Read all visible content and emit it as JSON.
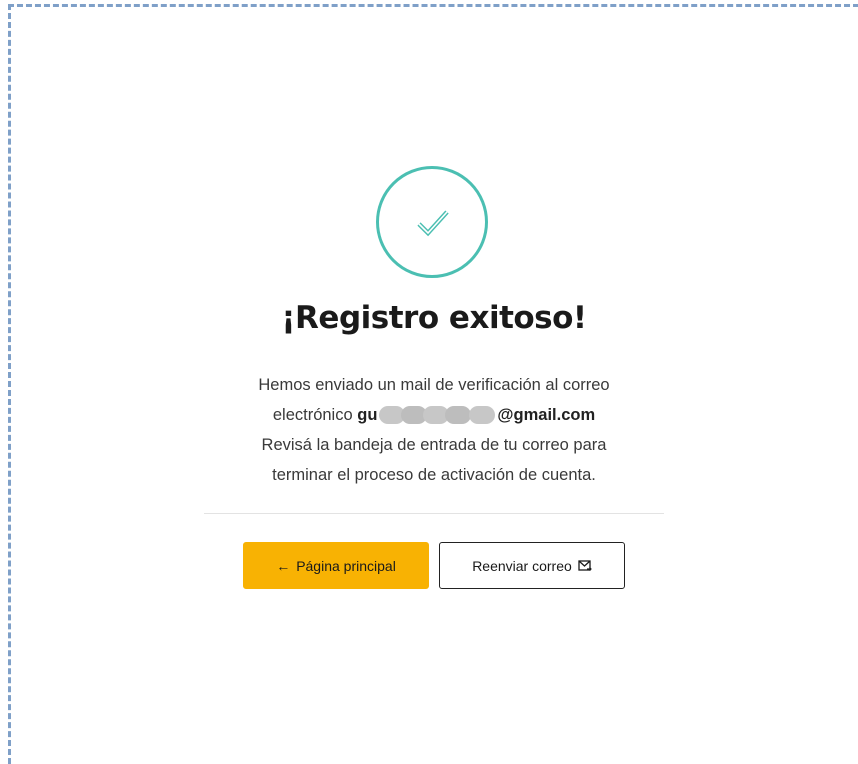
{
  "success": {
    "title": "¡Registro exitoso!",
    "message_line1": "Hemos enviado un mail de verificación al correo",
    "message_prefix": "electrónico",
    "email_visible_start": "gu",
    "email_visible_end": "@gmail.com",
    "message_line3": "Revisá la bandeja de entrada de tu correo para",
    "message_line4": "terminar el proceso de activación de cuenta."
  },
  "actions": {
    "home_label": "Página principal",
    "home_arrow": "←",
    "resend_label": "Reenviar correo"
  },
  "colors": {
    "accent_teal": "#4bbfb2",
    "primary_button": "#f8b203",
    "frame_border": "#7fa0c8"
  },
  "icons": {
    "check": "check-icon",
    "back": "arrow-left-icon",
    "resend": "mail-send-icon"
  }
}
